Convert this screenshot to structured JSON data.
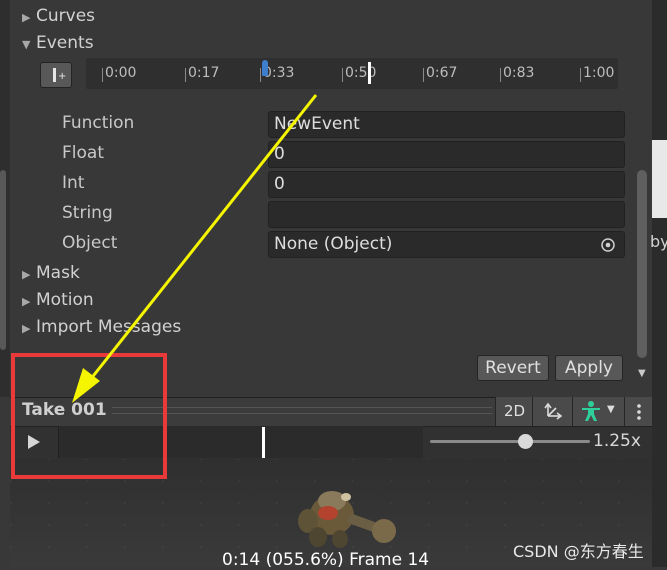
{
  "foldouts": {
    "curves": "Curves",
    "events": "Events",
    "mask": "Mask",
    "motion": "Motion",
    "import_messages": "Import Messages"
  },
  "timeline": {
    "ticks": [
      "0:00",
      "0:17",
      "0:33",
      "0:50",
      "0:67",
      "0:83",
      "1:00"
    ]
  },
  "event_props": {
    "function_label": "Function",
    "function_value": "NewEvent",
    "float_label": "Float",
    "float_value": "0",
    "int_label": "Int",
    "int_value": "0",
    "string_label": "String",
    "string_value": "",
    "object_label": "Object",
    "object_value": "None (Object)"
  },
  "buttons": {
    "revert": "Revert",
    "apply": "Apply"
  },
  "preview": {
    "title": "Take 001",
    "mode_2d": "2D",
    "speed": "1.25x",
    "speed_fraction": 0.6,
    "frame_info": "0:14 (055.6%) Frame 14"
  },
  "right_edge_text": "by",
  "watermark": "CSDN @东方春生",
  "colors": {
    "accent_marker": "#3d7ecf",
    "annotation_red": "#e8393b",
    "annotation_yellow": "#f5f500"
  },
  "icons": {
    "add_event": "add-event-icon",
    "object_picker": "object-picker-icon",
    "play": "play-icon",
    "pivot": "pivot-icon",
    "avatar": "avatar-icon",
    "more": "more-icon"
  }
}
